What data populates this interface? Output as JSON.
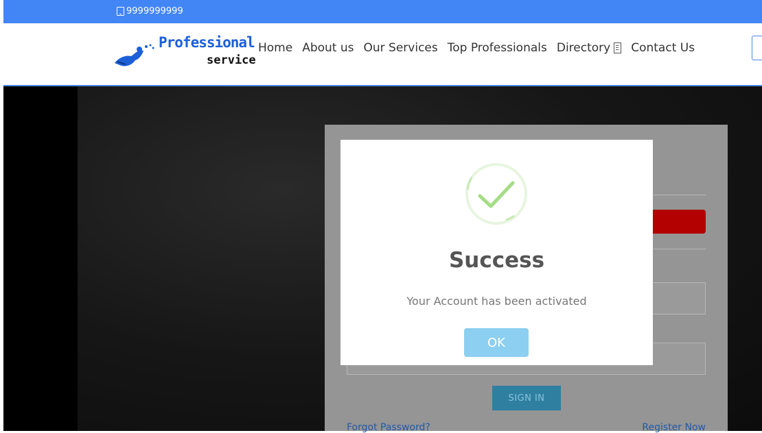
{
  "topbar": {
    "phone": "9999999999",
    "phone_icon": "phone-icon"
  },
  "logo": {
    "line1": "Professional",
    "line2": "service"
  },
  "nav": {
    "items": [
      {
        "label": "Home"
      },
      {
        "label": "About us"
      },
      {
        "label": "Our Services"
      },
      {
        "label": "Top Professionals"
      },
      {
        "label": "Directory"
      },
      {
        "label": "Contact Us"
      }
    ]
  },
  "login": {
    "signin_label": "SIGN IN",
    "forgot_label": "Forgot Password?",
    "register_label": "Register Now"
  },
  "modal": {
    "title": "Success",
    "message": "Your Account has been activated",
    "ok_label": "OK",
    "icon": "check-icon"
  },
  "colors": {
    "topbar": "#4285f4",
    "ok_button": "#8ccff0",
    "check": "#a5dc86"
  }
}
